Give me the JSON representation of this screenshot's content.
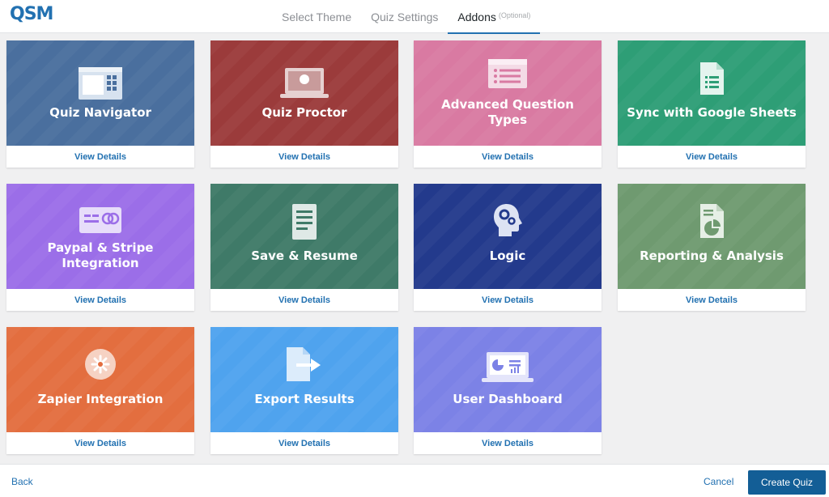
{
  "header": {
    "logo_text": "QSM",
    "tabs": [
      {
        "label": "Select Theme",
        "active": false
      },
      {
        "label": "Quiz Settings",
        "active": false
      },
      {
        "label": "Addons",
        "active": true,
        "note": "(Optional)"
      }
    ]
  },
  "addons": [
    {
      "title": "Quiz Navigator",
      "details": "View Details",
      "color": "#4a6f9e",
      "icon": "quiz-navigator-icon"
    },
    {
      "title": "Quiz Proctor",
      "details": "View Details",
      "color": "#9b3b3b",
      "icon": "proctor-laptop-icon"
    },
    {
      "title": "Advanced Question Types",
      "details": "View Details",
      "color": "#d97aa2",
      "icon": "question-list-icon"
    },
    {
      "title": "Sync with Google Sheets",
      "details": "View Details",
      "color": "#2e9e76",
      "icon": "google-sheets-icon"
    },
    {
      "title": "Paypal & Stripe Integration",
      "details": "View Details",
      "color": "#9b6ee8",
      "icon": "payment-card-icon"
    },
    {
      "title": "Save & Resume",
      "details": "View Details",
      "color": "#3f7a68",
      "icon": "document-icon"
    },
    {
      "title": "Logic",
      "details": "View Details",
      "color": "#233a8c",
      "icon": "brain-gear-icon"
    },
    {
      "title": "Reporting & Analysis",
      "details": "View Details",
      "color": "#6f9a70",
      "icon": "report-chart-icon"
    },
    {
      "title": "Zapier Integration",
      "details": "View Details",
      "color": "#e36e3f",
      "icon": "zapier-icon"
    },
    {
      "title": "Export Results",
      "details": "View Details",
      "color": "#4fa3ee",
      "icon": "export-file-icon"
    },
    {
      "title": "User Dashboard",
      "details": "View Details",
      "color": "#7c82e6",
      "icon": "dashboard-monitor-icon"
    }
  ],
  "footer": {
    "back_label": "Back",
    "cancel_label": "Cancel",
    "create_label": "Create Quiz"
  },
  "colors": {
    "accent": "#2271b1",
    "primary_button": "#135e96"
  }
}
